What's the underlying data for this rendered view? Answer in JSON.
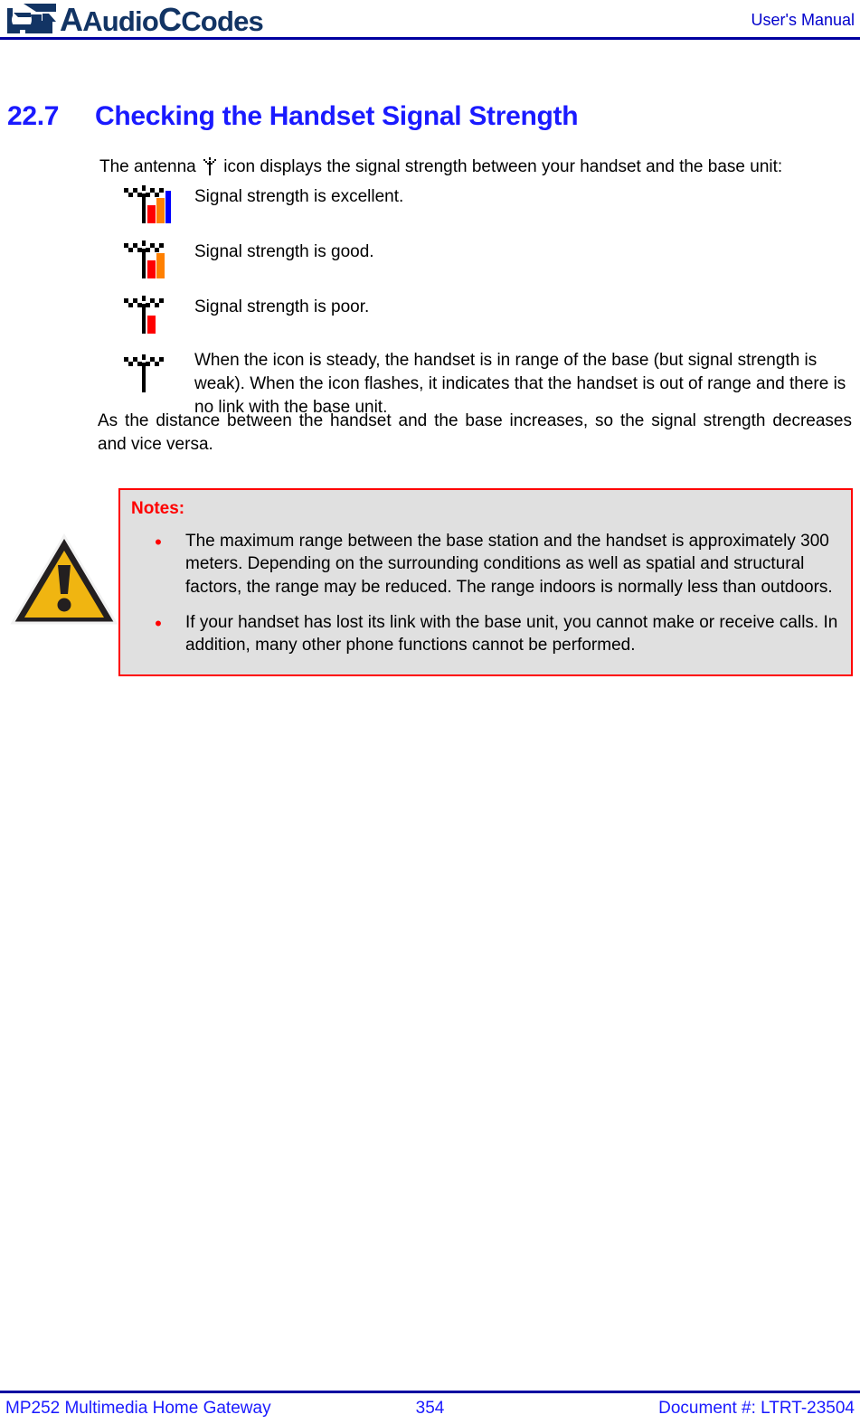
{
  "header": {
    "logo_icon": "audiocodes-logo-icon",
    "logo_text_audio": "Audio",
    "logo_text_codes": "Codes",
    "logo_text_full": "AudioCodes",
    "right_label": "User's Manual",
    "rule_color": "#0000a0"
  },
  "section": {
    "number": "22.7",
    "title": "Checking the Handset Signal Strength",
    "heading_color": "#1a1aff"
  },
  "intro": {
    "before_icon": "The antenna",
    "icon": "antenna-icon",
    "after_icon": "icon displays the signal strength between your handset and the base unit:"
  },
  "signal_levels": [
    {
      "icon": "signal-strength-excellent-icon",
      "bars": 3,
      "bar_colors": [
        "#ff0000",
        "#ff8000",
        "#0000ff"
      ],
      "description": "Signal strength is excellent."
    },
    {
      "icon": "signal-strength-good-icon",
      "bars": 2,
      "bar_colors": [
        "#ff0000",
        "#ff8000"
      ],
      "description": "Signal strength is good."
    },
    {
      "icon": "signal-strength-poor-icon",
      "bars": 1,
      "bar_colors": [
        "#ff0000"
      ],
      "description": "Signal strength is poor."
    },
    {
      "icon": "signal-strength-none-icon",
      "bars": 0,
      "bar_colors": [],
      "description": "When the icon is steady, the handset is in range of the base (but signal strength is weak). When the icon flashes, it indicates that the handset is out of range and there is no link with the base unit."
    }
  ],
  "distance_paragraph": "As the distance between the handset and the base increases, so the signal strength decreases and vice versa.",
  "note": {
    "warning_icon": "warning-triangle-icon",
    "title": "Notes:",
    "title_color": "#ff0000",
    "border_color": "#ff0000",
    "background_color": "#e0e0e0",
    "bullet_glyph": "•",
    "items": [
      "The maximum range between the base station and the handset is approximately 300 meters. Depending on the surrounding conditions as well as spatial and structural factors, the range may be reduced. The range indoors is normally less than outdoors.",
      "If your handset has lost its link with the base unit, you cannot make or receive calls. In addition, many other phone functions cannot be performed."
    ]
  },
  "footer": {
    "left": "MP252 Multimedia Home Gateway",
    "center": "354",
    "right": "Document #: LTRT-23504",
    "text_color": "#1a1aff",
    "rule_color": "#0000a0"
  }
}
